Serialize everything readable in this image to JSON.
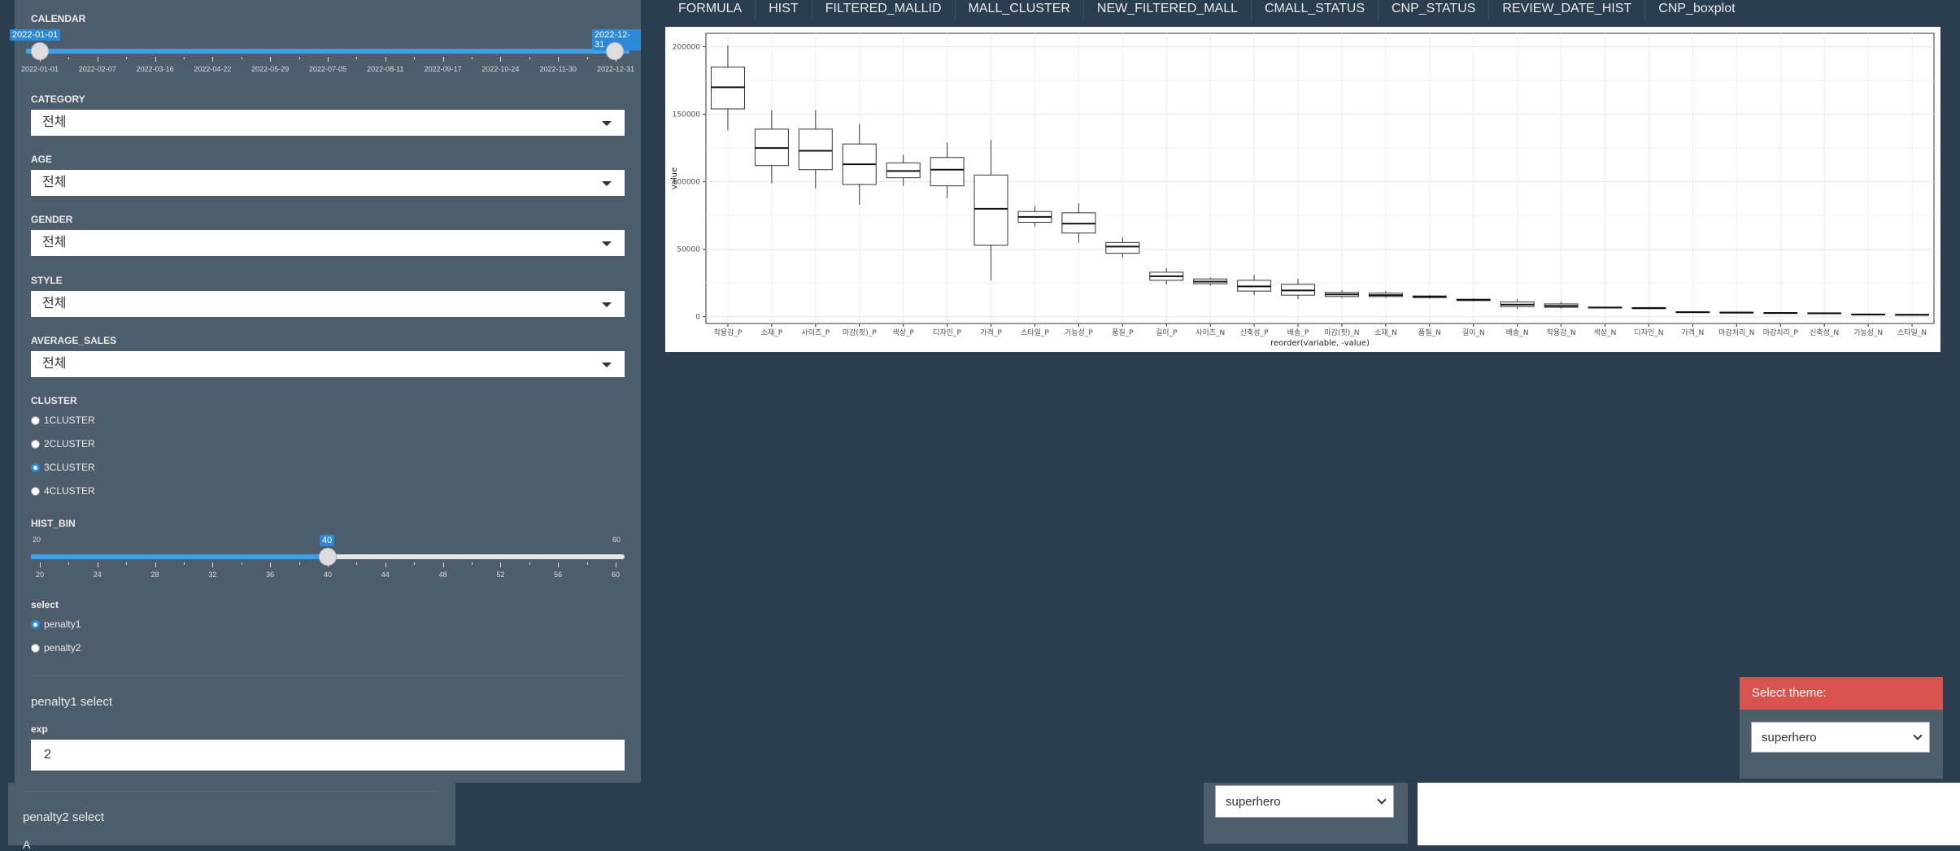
{
  "sidebar": {
    "calendar": {
      "label": "CALENDAR",
      "start": "2022-01-01",
      "end": "2022-12-31",
      "ticks": [
        "2022-01-01",
        "2022-02-07",
        "2022-03-16",
        "2022-04-22",
        "2022-05-29",
        "2022-07-05",
        "2022-08-11",
        "2022-09-17",
        "2022-10-24",
        "2022-11-30",
        "2022-12-31"
      ]
    },
    "category": {
      "label": "CATEGORY",
      "value": "전체"
    },
    "age": {
      "label": "AGE",
      "value": "전체"
    },
    "gender": {
      "label": "GENDER",
      "value": "전체"
    },
    "style": {
      "label": "STYLE",
      "value": "전체"
    },
    "average_sales": {
      "label": "AVERAGE_SALES",
      "value": "전체"
    },
    "cluster": {
      "label": "CLUSTER",
      "options": [
        "1CLUSTER",
        "2CLUSTER",
        "3CLUSTER",
        "4CLUSTER"
      ],
      "selected": "3CLUSTER"
    },
    "hist_bin": {
      "label": "HIST_BIN",
      "min": "20",
      "max": "60",
      "value": "40",
      "ticks": [
        "20",
        "24",
        "28",
        "32",
        "36",
        "40",
        "44",
        "48",
        "52",
        "56",
        "60"
      ]
    },
    "select": {
      "label": "select",
      "options": [
        "penalty1",
        "penalty2"
      ],
      "selected": "penalty1"
    },
    "penalty1": {
      "title": "penalty1 select",
      "exp_label": "exp",
      "exp_value": "2"
    },
    "penalty2": {
      "title": "penalty2 select",
      "partial": "A"
    }
  },
  "tabs": [
    "FORMULA",
    "HIST",
    "FILTERED_MALLID",
    "MALL_CLUSTER",
    "NEW_FILTERED_MALL",
    "CMALL_STATUS",
    "CNP_STATUS",
    "REVIEW_DATE_HIST",
    "CNP_boxplot"
  ],
  "theme": {
    "title": "Select theme:",
    "value": "superhero"
  },
  "bottom_select": {
    "value": "superhero"
  },
  "chart_data": {
    "type": "boxplot",
    "xlabel": "reorder(variable, -value)",
    "ylabel": "value",
    "ylim": [
      -5000,
      210000
    ],
    "yticks": [
      0,
      50000,
      100000,
      150000,
      200000
    ],
    "grid": true,
    "categories": [
      "착용감_P",
      "소재_P",
      "사이즈_P",
      "마감(핏)_P",
      "색상_P",
      "디자인_P",
      "가격_P",
      "스타일_P",
      "기능성_P",
      "품질_P",
      "길이_P",
      "사이즈_N",
      "신축성_P",
      "배송_P",
      "마감(핏)_N",
      "소재_N",
      "품질_N",
      "길이_N",
      "배송_N",
      "착용감_N",
      "색상_N",
      "디자인_N",
      "가격_N",
      "마감처리_N",
      "마감처리_P",
      "신축성_N",
      "기능성_N",
      "스타일_N"
    ],
    "boxes": [
      {
        "min": 138000,
        "q1": 154000,
        "median": 170000,
        "q3": 185000,
        "max": 201000
      },
      {
        "min": 99000,
        "q1": 112000,
        "median": 125000,
        "q3": 139000,
        "max": 153000
      },
      {
        "min": 95000,
        "q1": 109000,
        "median": 123000,
        "q3": 139000,
        "max": 153000
      },
      {
        "min": 83000,
        "q1": 98000,
        "median": 113000,
        "q3": 128000,
        "max": 143000
      },
      {
        "min": 97000,
        "q1": 103000,
        "median": 108000,
        "q3": 114000,
        "max": 120000
      },
      {
        "min": 88000,
        "q1": 97000,
        "median": 109000,
        "q3": 118000,
        "max": 129000
      },
      {
        "min": 27000,
        "q1": 53000,
        "median": 80000,
        "q3": 105000,
        "max": 131000
      },
      {
        "min": 67000,
        "q1": 70000,
        "median": 74000,
        "q3": 78000,
        "max": 82000
      },
      {
        "min": 55000,
        "q1": 62000,
        "median": 69000,
        "q3": 77000,
        "max": 84000
      },
      {
        "min": 44000,
        "q1": 47000,
        "median": 52000,
        "q3": 55000,
        "max": 59000
      },
      {
        "min": 24000,
        "q1": 27000,
        "median": 30000,
        "q3": 33000,
        "max": 36000
      },
      {
        "min": 23000,
        "q1": 24500,
        "median": 26000,
        "q3": 28000,
        "max": 29000
      },
      {
        "min": 16000,
        "q1": 19000,
        "median": 22500,
        "q3": 27000,
        "max": 31000
      },
      {
        "min": 13000,
        "q1": 16000,
        "median": 19500,
        "q3": 24000,
        "max": 28000
      },
      {
        "min": 14000,
        "q1": 15000,
        "median": 16500,
        "q3": 18000,
        "max": 19500
      },
      {
        "min": 14000,
        "q1": 15000,
        "median": 16000,
        "q3": 17500,
        "max": 19000
      },
      {
        "min": 13500,
        "q1": 14200,
        "median": 14800,
        "q3": 15400,
        "max": 16000
      },
      {
        "min": 11500,
        "q1": 12000,
        "median": 12500,
        "q3": 13000,
        "max": 13500
      },
      {
        "min": 6000,
        "q1": 7500,
        "median": 9000,
        "q3": 11000,
        "max": 13000
      },
      {
        "min": 6000,
        "q1": 7000,
        "median": 8000,
        "q3": 9500,
        "max": 11000
      },
      {
        "min": 6200,
        "q1": 6500,
        "median": 6800,
        "q3": 7100,
        "max": 7400
      },
      {
        "min": 5600,
        "q1": 6000,
        "median": 6400,
        "q3": 6800,
        "max": 7200
      },
      {
        "min": 3000,
        "q1": 3200,
        "median": 3400,
        "q3": 3600,
        "max": 3800
      },
      {
        "min": 2700,
        "q1": 2900,
        "median": 3100,
        "q3": 3300,
        "max": 3500
      },
      {
        "min": 2400,
        "q1": 2600,
        "median": 2800,
        "q3": 3000,
        "max": 3200
      },
      {
        "min": 2200,
        "q1": 2400,
        "median": 2600,
        "q3": 2800,
        "max": 3000
      },
      {
        "min": 1300,
        "q1": 1500,
        "median": 1700,
        "q3": 1900,
        "max": 2100
      },
      {
        "min": 1100,
        "q1": 1300,
        "median": 1500,
        "q3": 1700,
        "max": 1900
      }
    ]
  }
}
